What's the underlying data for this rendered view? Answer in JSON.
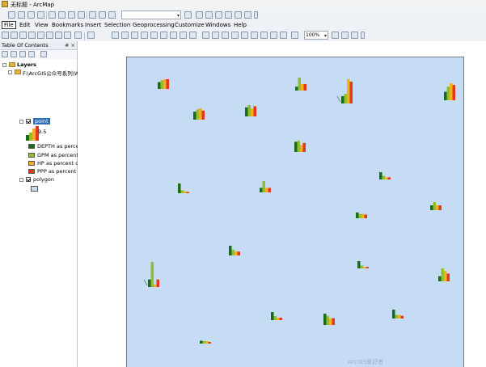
{
  "window": {
    "title": "无标题 - ArcMap"
  },
  "menu": {
    "items": [
      "File",
      "Edit",
      "View",
      "Bookmarks",
      "Insert",
      "Selection",
      "Geoprocessing",
      "Customize",
      "Windows",
      "Help"
    ]
  },
  "toolbar": {
    "zoom": "100%"
  },
  "toc": {
    "title": "Table Of Contents",
    "header_buttons": "# ×",
    "root": "Layers",
    "folder": "F:\\ArcGIS公众号系列\\W",
    "layer_point": "point",
    "size_label": "9.5",
    "legend": [
      {
        "label": "DEPTH as percent",
        "color": "#1a6b1a"
      },
      {
        "label": "GPM as percent",
        "color": "#8fbf2f"
      },
      {
        "label": "HP as percent c",
        "color": "#f0b020"
      },
      {
        "label": "PPP as percent",
        "color": "#e03a1e"
      }
    ],
    "layer_polygon": "polygon",
    "polygon_color": "#c6dbf4"
  },
  "map_symbols": [
    {
      "v": [
        0.7,
        0.9,
        1.0,
        1.0
      ],
      "scale": 12
    },
    {
      "v": [
        0.3,
        1.0,
        0.5,
        0.5
      ],
      "scale": 16
    },
    {
      "v": [
        0.3,
        0.4,
        1.0,
        0.9
      ],
      "scale": 30
    },
    {
      "v": [
        0.5,
        0.8,
        1.0,
        0.9
      ],
      "scale": 21
    },
    {
      "v": [
        0.7,
        0.9,
        1.0,
        0.8
      ],
      "scale": 14
    },
    {
      "v": [
        0.8,
        1.0,
        0.7,
        0.9
      ],
      "scale": 14
    },
    {
      "v": [
        0.9,
        1.0,
        0.6,
        0.8
      ],
      "scale": 14
    },
    {
      "v": [
        1.0,
        0.3,
        0.2,
        0.1
      ],
      "scale": 12
    },
    {
      "v": [
        0.4,
        1.0,
        0.4,
        0.4
      ],
      "scale": 14
    },
    {
      "v": [
        1.0,
        0.5,
        0.3,
        0.3
      ],
      "scale": 9
    },
    {
      "v": [
        0.6,
        1.0,
        0.6,
        0.6
      ],
      "scale": 10
    },
    {
      "v": [
        0.8,
        0.6,
        0.6,
        0.5
      ],
      "scale": 9
    },
    {
      "v": [
        1.0,
        0.6,
        0.4,
        0.4
      ],
      "scale": 12
    },
    {
      "v": [
        0.3,
        1.0,
        0.1,
        0.3
      ],
      "scale": 31
    },
    {
      "v": [
        1.0,
        0.4,
        0.2,
        0.2
      ],
      "scale": 9
    },
    {
      "v": [
        0.4,
        1.0,
        0.8,
        0.6
      ],
      "scale": 16
    },
    {
      "v": [
        1.0,
        0.5,
        0.3,
        0.3
      ],
      "scale": 10
    },
    {
      "v": [
        1.0,
        0.8,
        0.6,
        0.6
      ],
      "scale": 14
    },
    {
      "v": [
        1.0,
        0.4,
        0.4,
        0.3
      ],
      "scale": 11
    },
    {
      "v": [
        0.7,
        0.6,
        0.6,
        0.4
      ],
      "scale": 5
    }
  ],
  "watermark": "ArcGIS爱好者"
}
